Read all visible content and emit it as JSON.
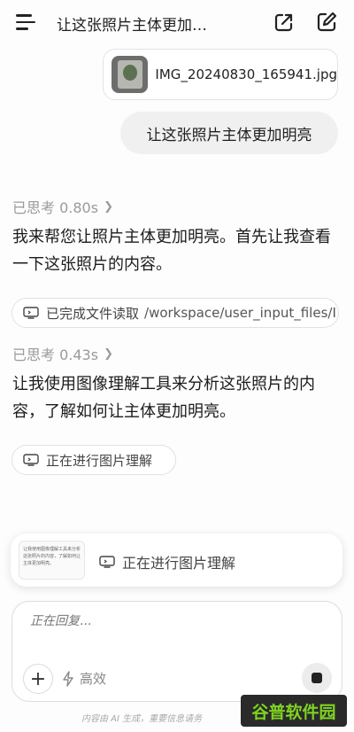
{
  "header": {
    "title": "让这张照片主体更加…"
  },
  "attachment": {
    "filename": "IMG_20240830_165941.jpg"
  },
  "user_message": "让这张照片主体更加明亮",
  "steps": [
    {
      "think_label": "已思考 0.80s",
      "reply": "我来帮您让照片主体更加明亮。首先让我查看一下这张照片的内容。",
      "tool_status": "已完成文件读取",
      "tool_detail": "/workspace/user_input_files/I"
    },
    {
      "think_label": "已思考 0.43s",
      "reply": "让我使用图像理解工具来分析这张照片的内容，了解如何让主体更加明亮。",
      "tool_status": "正在进行图片理解"
    }
  ],
  "task_card": {
    "preview_text": "让我使用图像理解工具来分析这张照片的内容，了解如何让主体更加明亮。",
    "label": "正在进行图片理解"
  },
  "composer": {
    "placeholder": "正在回复...",
    "mode_label": "高效"
  },
  "footer": {
    "note": "内容由 AI 生成，重要信息请务"
  },
  "watermark": {
    "text": "谷普软件园"
  },
  "colors": {
    "bubble_bg": "#f0f0f0",
    "muted": "#9a9a9a",
    "text": "#1b1b1b"
  }
}
